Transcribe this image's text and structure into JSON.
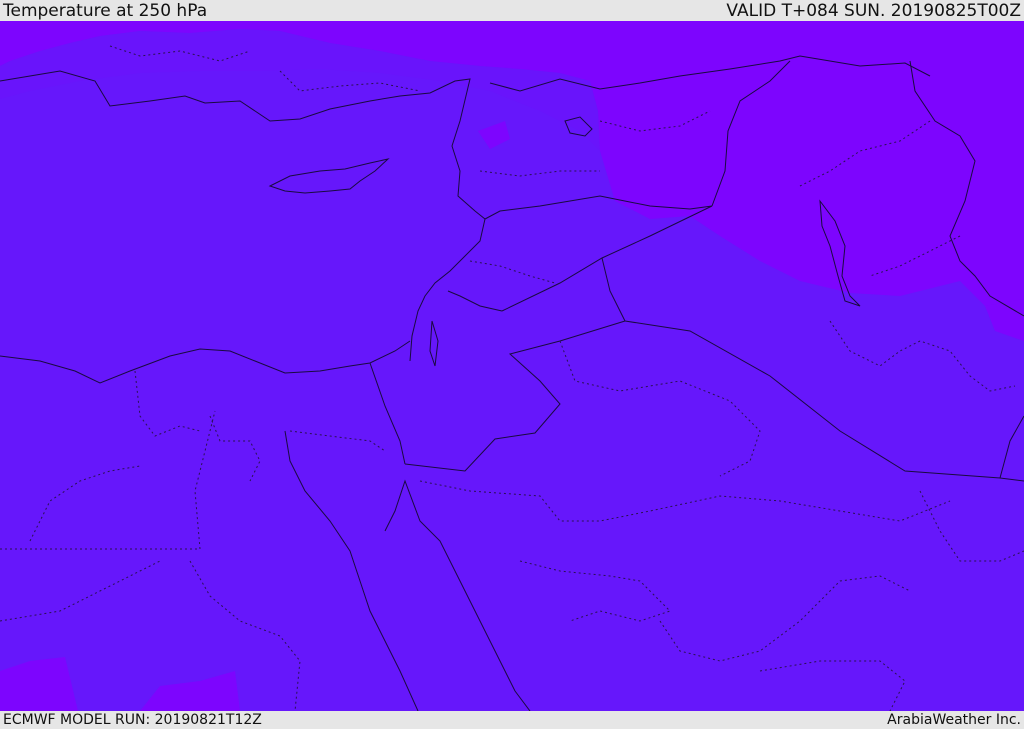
{
  "header": {
    "title": "Temperature at 250 hPa",
    "valid": "VALID T+084 SUN. 20190825T00Z"
  },
  "footer": {
    "model_run": "ECMWF MODEL RUN: 20190821T12Z",
    "credit": "ArabiaWeather Inc."
  },
  "colors": {
    "base_field": "#6617fb",
    "cold_field": "#7d05fe",
    "mid_field": "#6b12fc",
    "lines": "#1a0a40"
  }
}
